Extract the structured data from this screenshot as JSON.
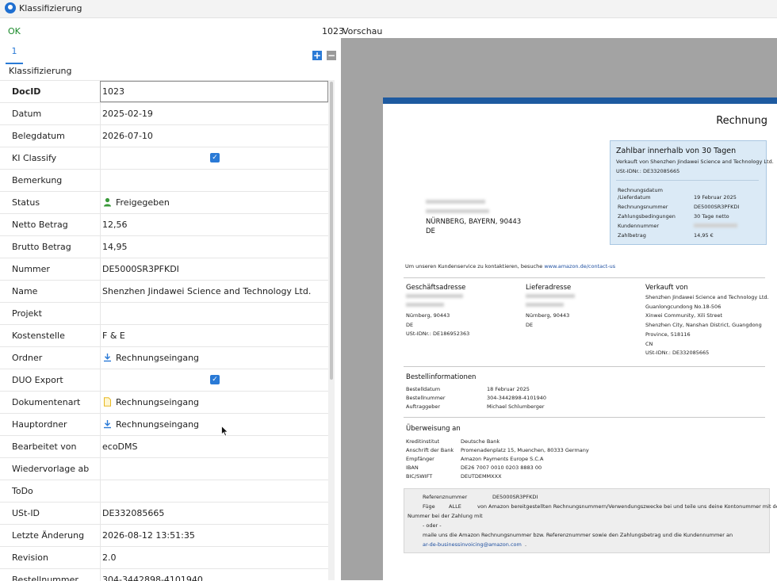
{
  "window": {
    "title": "Klassifizierung"
  },
  "toolbar": {
    "ok_label": "OK",
    "doc_number": "1023",
    "preview_label": "Vorschau"
  },
  "tabs": [
    {
      "label": "1"
    }
  ],
  "section": {
    "label": "Klassifizierung"
  },
  "form_rows": [
    {
      "label": "DocID",
      "value": "1023"
    },
    {
      "label": "Datum",
      "value": "2025-02-19"
    },
    {
      "label": "Belegdatum",
      "value": "2026-07-10"
    },
    {
      "label": "KI Classify",
      "value": ""
    },
    {
      "label": "Bemerkung",
      "value": ""
    },
    {
      "label": "Status",
      "value": "Freigegeben"
    },
    {
      "label": "Netto Betrag",
      "value": "12,56"
    },
    {
      "label": "Brutto Betrag",
      "value": "14,95"
    },
    {
      "label": "Nummer",
      "value": "DE5000SR3PFKDI"
    },
    {
      "label": "Name",
      "value": "Shenzhen Jindawei Science and Technology Ltd."
    },
    {
      "label": "Projekt",
      "value": ""
    },
    {
      "label": "Kostenstelle",
      "value": "F & E"
    },
    {
      "label": "Ordner",
      "value": "Rechnungseingang"
    },
    {
      "label": "DUO Export",
      "value": ""
    },
    {
      "label": "Dokumentenart",
      "value": "Rechnungseingang"
    },
    {
      "label": "Hauptordner",
      "value": "Rechnungseingang"
    },
    {
      "label": "Bearbeitet von",
      "value": "ecoDMS"
    },
    {
      "label": "Wiedervorlage ab",
      "value": ""
    },
    {
      "label": "ToDo",
      "value": ""
    },
    {
      "label": "USt-ID",
      "value": "DE332085665"
    },
    {
      "label": "Letzte Änderung",
      "value": "2026-08-12 13:51:35"
    },
    {
      "label": "Revision",
      "value": "2.0"
    },
    {
      "label": "Bestellnummer",
      "value": "304-3442898-4101940"
    }
  ],
  "invoice": {
    "title": "Rechnung",
    "box_heading": "Zahlbar innerhalb von 30 Tagen",
    "sold_by": "Verkauft von Shenzhen Jindawei Science and Technology Ltd.",
    "vat_line": "USt-IDNr.: DE332085665",
    "box_rows": [
      {
        "label": "Rechnungsdatum",
        "value": ""
      },
      {
        "label": "/Lieferdatum",
        "value": "19 Februar 2025"
      },
      {
        "label": "Rechnungsnummer",
        "value": "DE5000SR3PFKDI"
      },
      {
        "label": "Zahlungsbedingungen",
        "value": "30 Tage netto"
      },
      {
        "label": "Kundennummer",
        "value": ""
      },
      {
        "label": "Zahlbetrag",
        "value": "14,95 €"
      }
    ],
    "recipient_city": "NÜRNBERG, BAYERN, 90443",
    "recipient_country": "DE",
    "contact_text": "Um unseren Kundenservice zu kontaktieren, besuche",
    "contact_link": "www.amazon.de/contact-us",
    "billing_heading": "Geschäftsadresse",
    "billing_city": "Nürnberg, 90443",
    "billing_country": "DE",
    "billing_vat": "USt-IDNr.: DE186952363",
    "delivery_heading": "Lieferadresse",
    "delivery_city": "Nürnberg, 90443",
    "delivery_country": "DE",
    "seller_heading": "Verkauft von",
    "seller_lines": [
      "Shenzhen Jindawei Science and Technology Ltd.",
      "Guanlongcundong No.18-506",
      "Xinwei Community, Xili Street",
      "Shenzhen City, Nanshan District, Guangdong",
      "Province, 518116",
      "CN",
      "USt-IDNr.: DE332085665"
    ],
    "order_heading": "Bestellinformationen",
    "order_rows": [
      {
        "label": "Bestelldatum",
        "value": "18 Februar 2025"
      },
      {
        "label": "Bestellnummer",
        "value": "304-3442898-4101940"
      },
      {
        "label": "Auftraggeber",
        "value": "Michael Schlumberger"
      }
    ],
    "transfer_heading": "Überweisung an",
    "transfer_rows": [
      {
        "label": "Kreditinstitut",
        "value": "Deutsche Bank"
      },
      {
        "label": "Anschrift der Bank",
        "value": "Promenadenplatz 15, Muenchen, 80333 Germany"
      },
      {
        "label": "Empfänger",
        "value": "Amazon Payments Europe S.C.A"
      },
      {
        "label": "IBAN",
        "value": "DE26 7007 0010 0203 8883 00"
      },
      {
        "label": "BIC/SWIFT",
        "value": "DEUTDEMMXXX"
      }
    ],
    "ref_label": "Referenznummer",
    "ref_value": "DE5000SR3PFKDI",
    "note_line1_a": "Füge",
    "note_line1_b": "ALLE",
    "note_line1_c": "von Amazon bereitgestellten Rechnungsnummern/Verwendungszwecke bei und teile uns deine Kontonummer mit deiner EFT",
    "note_line2": "Nummer bei der Zahlung mit",
    "note_line3": "- oder -",
    "note_line4": "maile uns die Amazon Rechnungsnummer bzw. Referenznummer sowie den Zahlungsbetrag und die Kundennummer an",
    "note_email": "ar-de-businessinvoicing@amazon.com",
    "note_dot": "."
  },
  "colors": {
    "accent": "#2a7ad6",
    "ok_green": "#1a8a2a",
    "preview_bg": "#a3a3a3",
    "invoice_bar": "#1e5aa0",
    "box_bg": "#dbeaf6"
  }
}
